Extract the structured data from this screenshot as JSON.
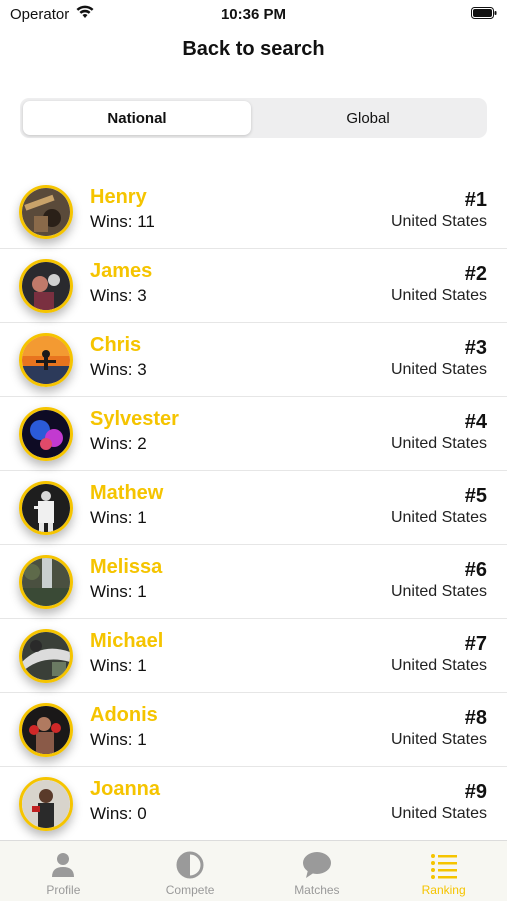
{
  "status_bar": {
    "carrier": "Operator",
    "time": "10:36 PM"
  },
  "nav": {
    "title": "Back to search"
  },
  "segments": {
    "national": "National",
    "global": "Global",
    "selected": "National"
  },
  "rankings": [
    {
      "name": "Henry",
      "wins": "Wins: 11",
      "rank": "#1",
      "country": "United States"
    },
    {
      "name": "James",
      "wins": "Wins: 3",
      "rank": "#2",
      "country": "United States"
    },
    {
      "name": "Chris",
      "wins": "Wins: 3",
      "rank": "#3",
      "country": "United States"
    },
    {
      "name": "Sylvester",
      "wins": "Wins: 2",
      "rank": "#4",
      "country": "United States"
    },
    {
      "name": "Mathew",
      "wins": "Wins: 1",
      "rank": "#5",
      "country": "United States"
    },
    {
      "name": "Melissa",
      "wins": "Wins: 1",
      "rank": "#6",
      "country": "United States"
    },
    {
      "name": "Michael",
      "wins": "Wins: 1",
      "rank": "#7",
      "country": "United States"
    },
    {
      "name": "Adonis",
      "wins": "Wins: 1",
      "rank": "#8",
      "country": "United States"
    },
    {
      "name": "Joanna",
      "wins": "Wins: 0",
      "rank": "#9",
      "country": "United States"
    }
  ],
  "tabs": [
    {
      "label": "Profile",
      "icon": "person-icon"
    },
    {
      "label": "Compete",
      "icon": "half-circle-icon"
    },
    {
      "label": "Matches",
      "icon": "speech-bubble-icon"
    },
    {
      "label": "Ranking",
      "icon": "list-icon"
    }
  ],
  "active_tab": "Ranking",
  "colors": {
    "accent": "#f5c400",
    "tab_inactive": "#9a9a9a",
    "text": "#111111"
  }
}
